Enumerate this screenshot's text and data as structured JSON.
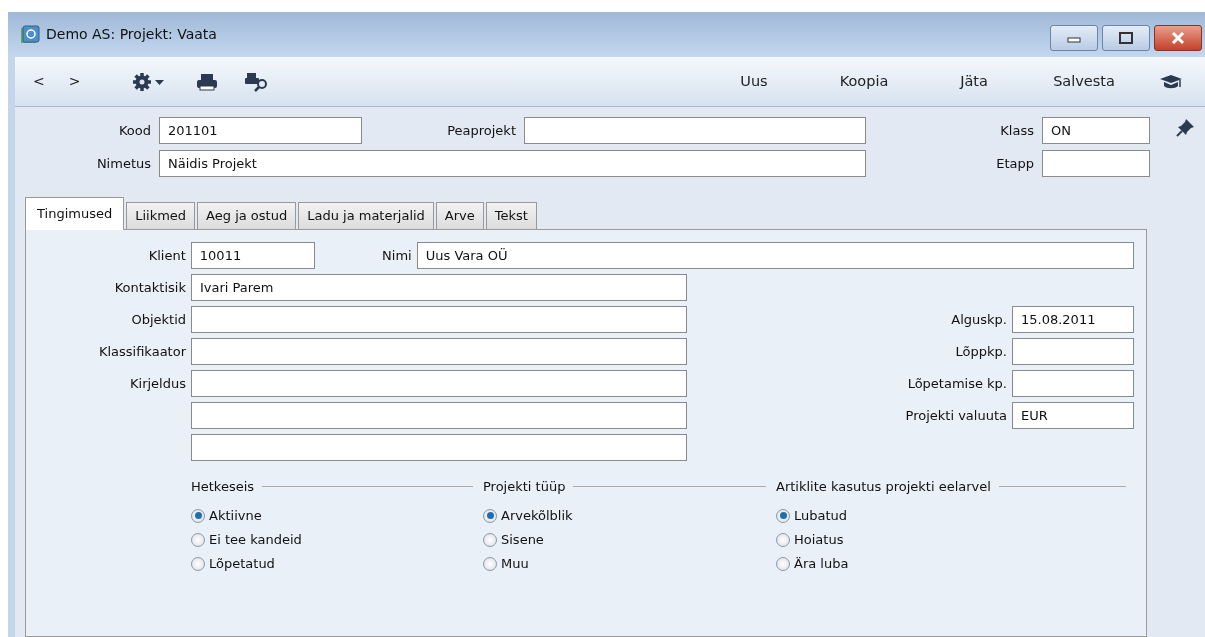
{
  "window": {
    "title": "Demo AS: Projekt: Vaata"
  },
  "toolbar": {
    "nav": [
      "<",
      ">"
    ],
    "actions": [
      "Uus",
      "Koopia",
      "Jäta",
      "Salvesta"
    ]
  },
  "header": {
    "fields": [
      {
        "label": "Kood",
        "value": "201101"
      },
      {
        "label": "Peaprojekt"
      },
      {
        "label": "Klass",
        "value": "ON"
      },
      {
        "label": "Nimetus",
        "value": "Näidis Projekt"
      },
      {
        "label": "Etapp"
      }
    ]
  },
  "tabs": [
    {
      "label": "Tingimused",
      "selected": true
    },
    {
      "label": "Liikmed",
      "selected": false
    },
    {
      "label": "Aeg ja ostud",
      "selected": false
    },
    {
      "label": "Ladu ja materjalid",
      "selected": false
    },
    {
      "label": "Arve",
      "selected": false
    },
    {
      "label": "Tekst",
      "selected": false
    }
  ],
  "panel": {
    "top_fields": [
      {
        "label": "Klient",
        "value": "10011"
      },
      {
        "label": "Nimi",
        "value": "Uus Vara OÜ"
      }
    ],
    "left_fields": [
      {
        "label": "Kontaktisik",
        "value": "Ivari Parem",
        "kind": "single"
      },
      {
        "label": "Objektid",
        "kind": "single"
      },
      {
        "label": "Klassifikaator",
        "kind": "single"
      },
      {
        "label": "Kirjeldus",
        "kind": "multiline"
      }
    ],
    "right_fields": [
      {
        "label": "Alguskp.",
        "value": "15.08.2011"
      },
      {
        "label": "Lõppkp."
      },
      {
        "label": "Lõpetamise kp."
      },
      {
        "label": "Projekti valuuta",
        "value": "EUR"
      }
    ],
    "radio_groups": [
      {
        "title": "Hetkeseis",
        "options": [
          {
            "label": "Aktiivne",
            "selected": true
          },
          {
            "label": "Ei tee kandeid",
            "selected": false
          },
          {
            "label": "Lõpetatud",
            "selected": false
          }
        ]
      },
      {
        "title": "Projekti tüüp",
        "options": [
          {
            "label": "Arvekõlblik",
            "selected": true
          },
          {
            "label": "Sisene",
            "selected": false
          },
          {
            "label": "Muu",
            "selected": false
          }
        ]
      },
      {
        "title": "Artiklite kasutus projekti eelarvel",
        "options": [
          {
            "label": "Lubatud",
            "selected": true
          },
          {
            "label": "Hoiatus",
            "selected": false
          },
          {
            "label": "Ära luba",
            "selected": false
          }
        ]
      }
    ]
  }
}
